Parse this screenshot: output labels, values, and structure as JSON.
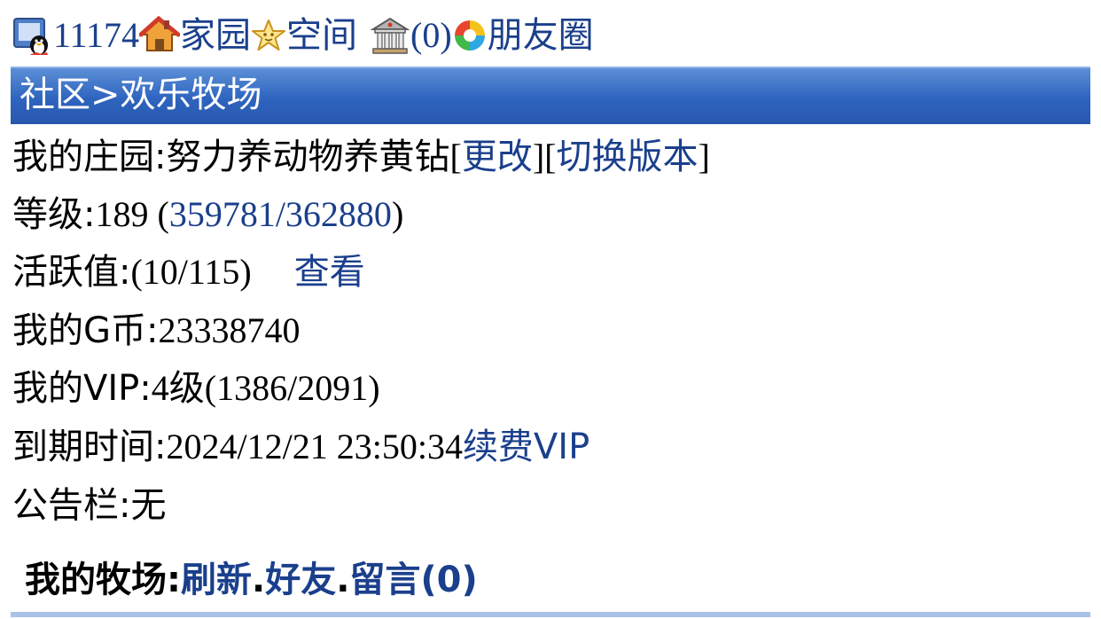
{
  "topbar": {
    "qq_number": "11174",
    "home_label": "家园",
    "space_label": "空间",
    "message_count": "(0)",
    "moments_label": "朋友圈"
  },
  "header": {
    "breadcrumb": "社区>欢乐牧场"
  },
  "manor": {
    "label": "我的庄园:",
    "name": "努力养动物养黄钻",
    "change_open": "[",
    "change_link": "更改",
    "change_close": "]",
    "switch_open": "[",
    "switch_link": "切换版本",
    "switch_close": "]"
  },
  "level": {
    "label": "等级:",
    "value": "189",
    "open": " (",
    "exp_link": "359781/362880",
    "close": ")"
  },
  "activity": {
    "label": "活跃值:",
    "value": "(10/115)",
    "view_link": "查看"
  },
  "coins": {
    "label": "我的G币:",
    "value": "23338740"
  },
  "vip": {
    "label": "我的VIP:",
    "value": "4级(1386/2091)"
  },
  "expiry": {
    "label": "到期时间:",
    "value": "2024/12/21 23:50:34",
    "renew_link": "续费VIP"
  },
  "notice": {
    "label": "公告栏:",
    "value": "无"
  },
  "my_farm": {
    "label": "我的牧场:",
    "refresh_link": "刷新",
    "sep1": ".",
    "friends_link": "好友",
    "sep2": ".",
    "messages_link": "留言(0)"
  },
  "colors": {
    "link": "#1a3f8c",
    "header_bg": "#2e64bf",
    "header_text": "#ffffff",
    "rule": "#a9c3e6"
  }
}
